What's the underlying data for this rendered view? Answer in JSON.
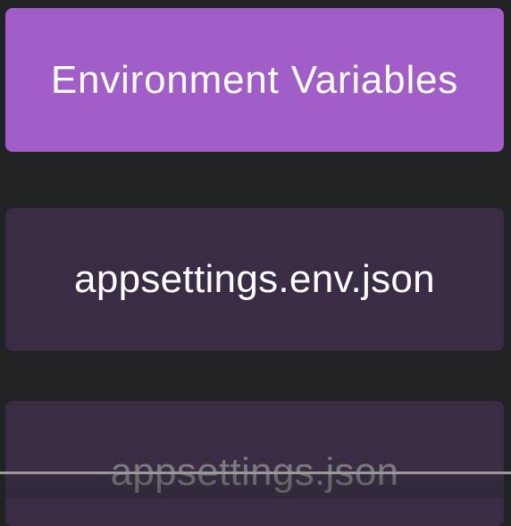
{
  "options": [
    {
      "label": "Environment Variables",
      "state": "selected"
    },
    {
      "label": "appsettings.env.json",
      "state": "default"
    },
    {
      "label": "appsettings.json",
      "state": "partially-visible"
    }
  ],
  "colors": {
    "background": "#202223",
    "selected_card": "#a25ec8",
    "default_card": "#3a2c45",
    "label_text": "#ffffff",
    "faded_text": "#7b7a7b"
  }
}
